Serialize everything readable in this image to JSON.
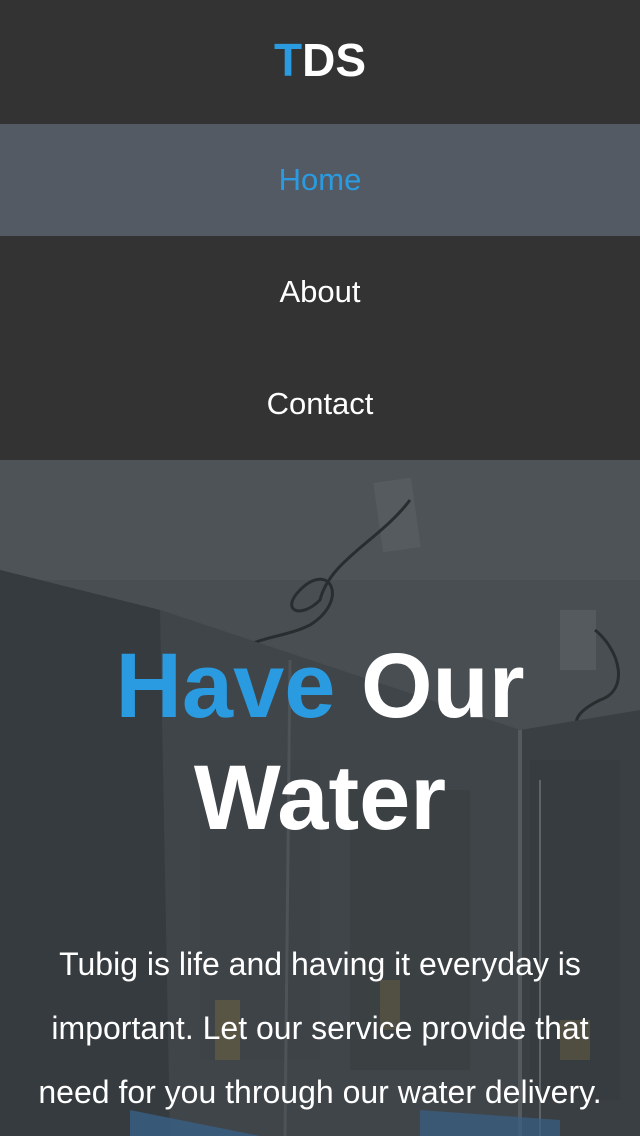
{
  "brand": {
    "logo_accent": "T",
    "logo_rest": "DS"
  },
  "nav": {
    "items": [
      {
        "label": "Home",
        "active": true
      },
      {
        "label": "About",
        "active": false
      },
      {
        "label": "Contact",
        "active": false
      }
    ]
  },
  "hero": {
    "title_accent": "Have",
    "title_rest": "Our Water",
    "description": "Tubig is life and having it everyday is important. Let our service provide that need for you through our water delivery."
  },
  "colors": {
    "accent": "#2a9be0",
    "header_bg": "#333333",
    "active_nav_bg": "#535a63",
    "text": "#ffffff"
  }
}
